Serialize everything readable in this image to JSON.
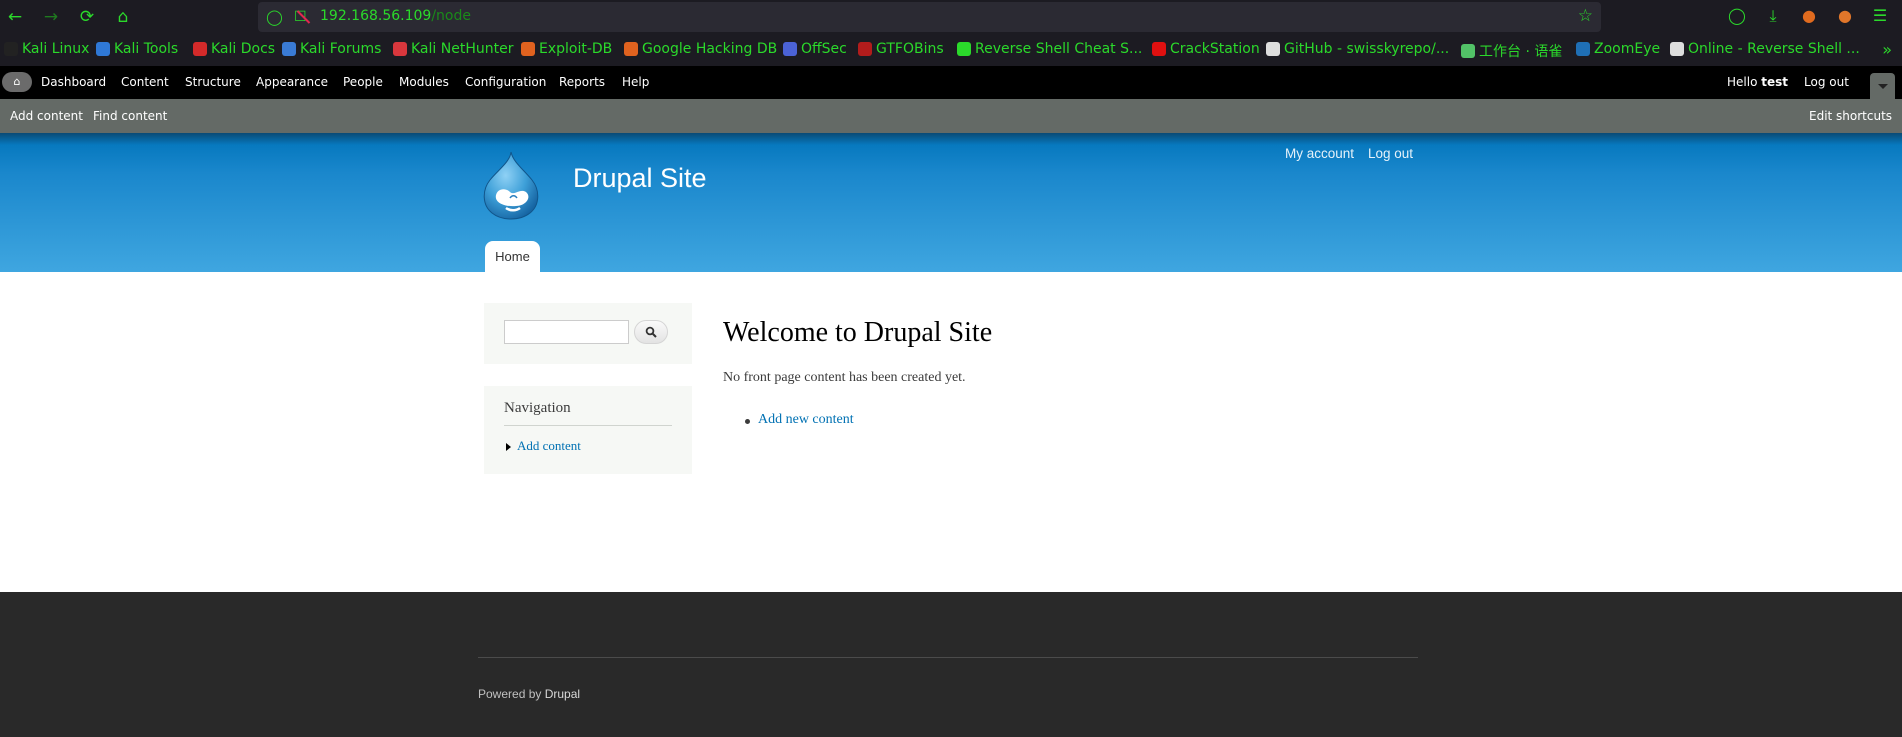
{
  "browser": {
    "url_host": "192.168.56.109",
    "url_path": "/node",
    "nav_icons": [
      "back-arrow-icon",
      "forward-arrow-icon",
      "reload-icon",
      "home-icon"
    ],
    "right_icons": [
      "pocket-icon",
      "download-icon",
      "extension-icon",
      "fox-icon",
      "hamburger-menu-icon"
    ],
    "bookmarks": [
      {
        "label": "Kali Linux",
        "icon": "kali-dragon-icon",
        "color": "#222222"
      },
      {
        "label": "Kali Tools",
        "icon": "kali-tools-icon",
        "color": "#2f78d6"
      },
      {
        "label": "Kali Docs",
        "icon": "kali-docs-icon",
        "color": "#d42a2a"
      },
      {
        "label": "Kali Forums",
        "icon": "kali-forums-icon",
        "color": "#3a7bd5"
      },
      {
        "label": "Kali NetHunter",
        "icon": "nethunter-icon",
        "color": "#d9373d"
      },
      {
        "label": "Exploit-DB",
        "icon": "exploit-db-icon",
        "color": "#e0621f"
      },
      {
        "label": "Google Hacking DB",
        "icon": "ghdb-icon",
        "color": "#e0621f"
      },
      {
        "label": "OffSec",
        "icon": "offsec-icon",
        "color": "#4b62d6"
      },
      {
        "label": "GTFOBins",
        "icon": "gtfobins-icon",
        "color": "#b21c1c"
      },
      {
        "label": "Reverse Shell Cheat S...",
        "icon": "globe-icon",
        "color": "#2bd92b"
      },
      {
        "label": "CrackStation",
        "icon": "crackstation-icon",
        "color": "#e01010"
      },
      {
        "label": "GitHub - swisskyrepo/...",
        "icon": "github-icon",
        "color": "#dddddd"
      },
      {
        "label": "工作台 · 语雀",
        "icon": "yuque-icon",
        "color": "#52c267"
      },
      {
        "label": "ZoomEye",
        "icon": "zoomeye-icon",
        "color": "#1f6fb5"
      },
      {
        "label": "Online - Reverse Shell ...",
        "icon": "skull-icon",
        "color": "#dddddd"
      }
    ]
  },
  "admin_toolbar": {
    "menu": [
      "Dashboard",
      "Content",
      "Structure",
      "Appearance",
      "People",
      "Modules",
      "Configuration",
      "Reports",
      "Help"
    ],
    "hello_prefix": "Hello ",
    "username": "test",
    "logout": "Log out"
  },
  "shortcuts": {
    "items": [
      "Add content",
      "Find content"
    ],
    "edit": "Edit shortcuts"
  },
  "header": {
    "site_name": "Drupal Site",
    "secondary_menu": [
      "My account",
      "Log out"
    ],
    "main_menu": [
      "Home"
    ]
  },
  "sidebar": {
    "search": {
      "placeholder": "",
      "value": "",
      "button_icon": "search-icon"
    },
    "navigation": {
      "title": "Navigation",
      "items": [
        "Add content"
      ]
    }
  },
  "main": {
    "title": "Welcome to Drupal Site",
    "message": "No front page content has been created yet.",
    "links": [
      "Add new content"
    ]
  },
  "footer": {
    "powered_prefix": "Powered by ",
    "powered_link": "Drupal"
  }
}
